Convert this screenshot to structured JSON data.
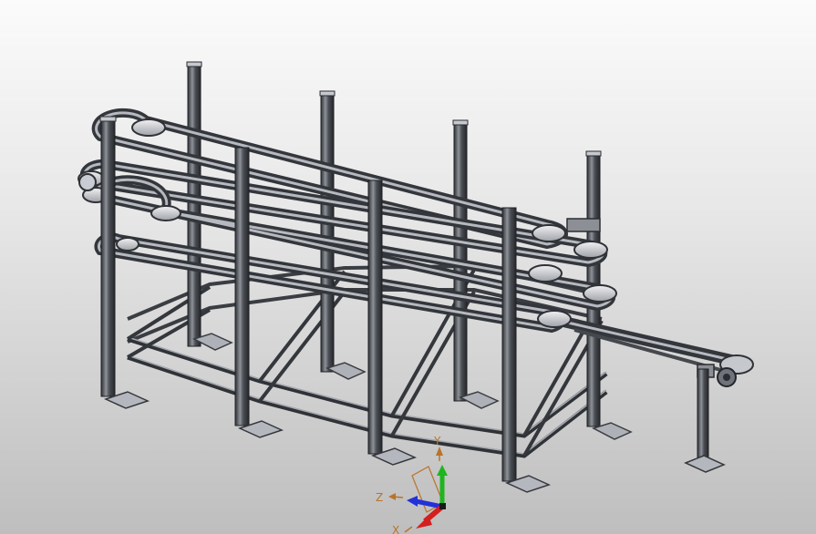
{
  "viewport": {
    "background_top": "#fbfbfb",
    "background_bottom": "#bebebe",
    "model": "conveyor-frame-assembly"
  },
  "triad": {
    "x_label": "X",
    "y_label": "Y",
    "z_label": "Z",
    "x_color": "#d41f1f",
    "y_color": "#1fb51f",
    "z_color": "#2430d8",
    "label_color": "#b8742b"
  },
  "colors": {
    "metal_dark": "#3a3d42",
    "metal_mid": "#7c8087",
    "metal_light": "#c9ccd2",
    "pulley": "#dcdde0"
  }
}
